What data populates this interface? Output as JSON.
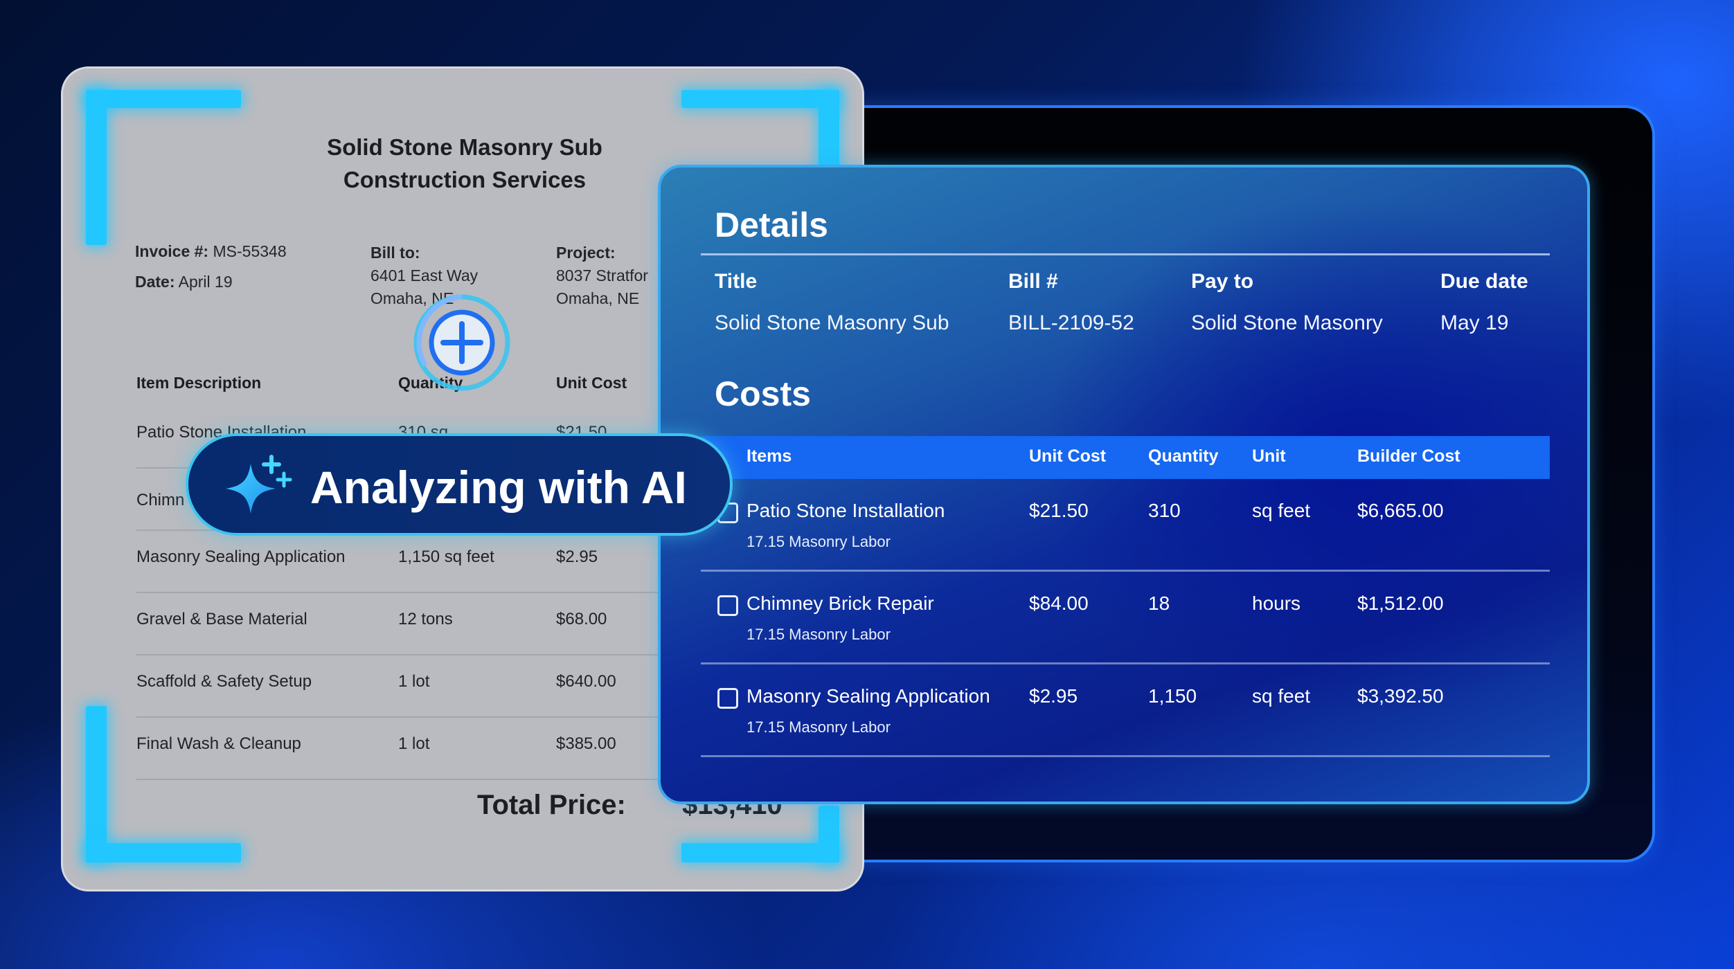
{
  "invoice": {
    "company_line1": "Solid Stone Masonry Sub",
    "company_line2": "Construction Services",
    "invoice_label": "Invoice #:",
    "invoice_number": "MS-55348",
    "date_label": "Date:",
    "date_value": "April 19",
    "bill_to_label": "Bill to:",
    "bill_to_line1": "6401 East Way",
    "bill_to_line2": "Omaha, NE",
    "project_label": "Project:",
    "project_line1": "8037 Stratfor",
    "project_line2": "Omaha, NE",
    "columns": [
      "Item Description",
      "Quantity",
      "Unit Cost"
    ],
    "rows": [
      {
        "description": "Patio Stone Installation",
        "quantity": "310 sq",
        "unit_cost": "$21.50"
      },
      {
        "description": "Chimn",
        "quantity": "",
        "unit_cost": ""
      },
      {
        "description": "Masonry Sealing Application",
        "quantity": "1,150 sq feet",
        "unit_cost": "$2.95"
      },
      {
        "description": "Gravel & Base Material",
        "quantity": "12 tons",
        "unit_cost": "$68.00"
      },
      {
        "description": "Scaffold & Safety Setup",
        "quantity": "1 lot",
        "unit_cost": "$640.00"
      },
      {
        "description": "Final Wash & Cleanup",
        "quantity": "1 lot",
        "unit_cost": "$385.00"
      }
    ],
    "total_label": "Total Price:",
    "total_value": "$13,410"
  },
  "ai_badge": {
    "text": "Analyzing with AI",
    "icon": "sparkle-icon"
  },
  "cursor": {
    "icon": "plus-circle-icon"
  },
  "details": {
    "section_title": "Details",
    "columns": [
      "Title",
      "Bill #",
      "Pay to",
      "Due date"
    ],
    "values": [
      "Solid Stone Masonry Sub",
      "BILL-2109-52",
      "Solid Stone Masonry",
      "May 19"
    ]
  },
  "costs": {
    "section_title": "Costs",
    "columns": [
      "Items",
      "Unit Cost",
      "Quantity",
      "Unit",
      "Builder Cost"
    ],
    "rows": [
      {
        "item": "Patio Stone Installation",
        "sub": "17.15 Masonry Labor",
        "unit_cost": "$21.50",
        "quantity": "310",
        "unit": "sq feet",
        "builder_cost": "$6,665.00"
      },
      {
        "item": "Chimney Brick Repair",
        "sub": "17.15 Masonry Labor",
        "unit_cost": "$84.00",
        "quantity": "18",
        "unit": "hours",
        "builder_cost": "$1,512.00"
      },
      {
        "item": "Masonry Sealing Application",
        "sub": "17.15 Masonry Labor",
        "unit_cost": "$2.95",
        "quantity": "1,150",
        "unit": "sq feet",
        "builder_cost": "$3,392.50"
      }
    ]
  },
  "colors": {
    "accent_cyan": "#22c7ff",
    "table_header_blue": "#1667f2",
    "badge_navy": "#072a6e",
    "invoice_gray": "#b9bbc0"
  }
}
